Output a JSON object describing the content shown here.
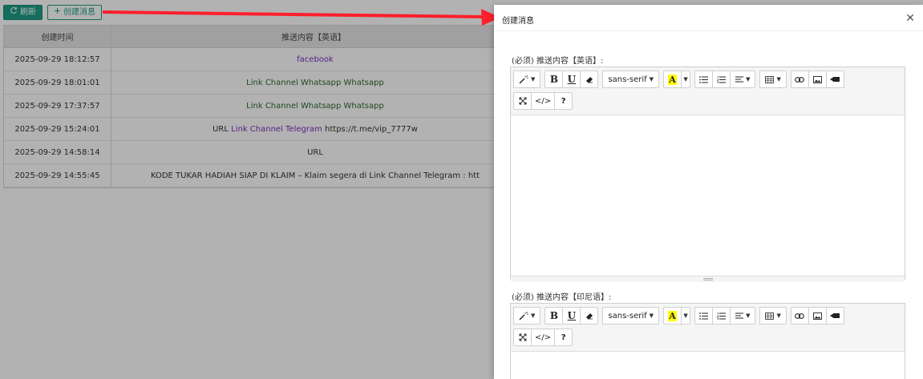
{
  "toolbar": {
    "refresh_label": "刷新",
    "refresh_icon": "refresh-icon",
    "create_label": "创建消息",
    "create_icon": "plus-icon"
  },
  "table": {
    "headers": [
      "创建时间",
      "推送内容【英语】"
    ],
    "rows": [
      {
        "time": "2025-09-29 18:12:57",
        "content_parts": [
          {
            "text": "facebook",
            "color": "purple"
          }
        ]
      },
      {
        "time": "2025-09-29 18:01:01",
        "content_parts": [
          {
            "text": "Link Channel Whatsapp Whatsapp",
            "color": "green"
          }
        ]
      },
      {
        "time": "2025-09-29 17:37:57",
        "content_parts": [
          {
            "text": "Link Channel Whatsapp Whatsapp",
            "color": "green"
          }
        ]
      },
      {
        "time": "2025-09-29 15:24:01",
        "content_parts": [
          {
            "text": "URL ",
            "color": "default"
          },
          {
            "text": "Link Channel Telegram",
            "color": "purple"
          },
          {
            "text": " https://t.me/vip_7777w",
            "color": "default"
          }
        ]
      },
      {
        "time": "2025-09-29 14:58:14",
        "content_parts": [
          {
            "text": "URL",
            "color": "default"
          }
        ]
      },
      {
        "time": "2025-09-29 14:55:45",
        "content_parts": [
          {
            "text": "KODE TUKAR HADIAH SIAP DI KLAIM – Klaim segera di Link Channel Telegram : htt",
            "color": "default"
          }
        ]
      }
    ]
  },
  "dialog": {
    "title": "创建消息",
    "close_icon": "close-icon",
    "fields": [
      {
        "label": "(必须) 推送内容【英语】:"
      },
      {
        "label": "(必须) 推送内容【印尼语】:"
      }
    ],
    "editor_toolbar": {
      "magic_icon": "magic-wand-icon",
      "bold": "B",
      "underline": "U",
      "eraser_icon": "eraser-icon",
      "font": "sans-serif",
      "color_letter": "A",
      "ul_icon": "unordered-list-icon",
      "ol_icon": "ordered-list-icon",
      "align_icon": "align-icon",
      "table_icon": "table-icon",
      "link_icon": "link-icon",
      "image_icon": "image-icon",
      "video_icon": "video-icon",
      "fullscreen_icon": "fullscreen-icon",
      "code": "</>",
      "help": "?"
    }
  },
  "colors": {
    "accent": "#1e9d86",
    "link_purple": "#7b2fbf",
    "annotation_red": "#ff1f2d"
  }
}
